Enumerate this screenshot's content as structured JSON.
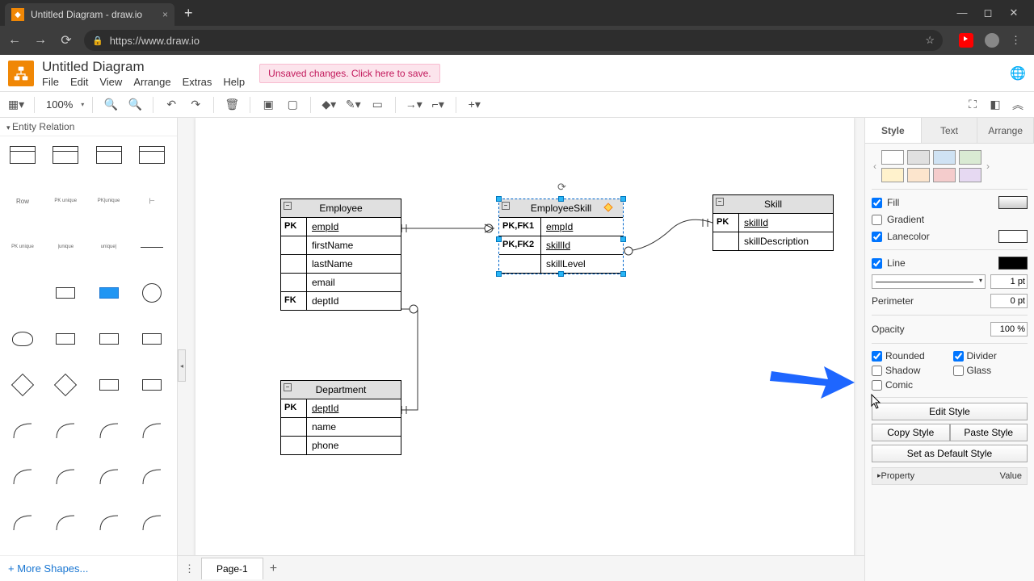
{
  "browser": {
    "tab_title": "Untitled Diagram - draw.io",
    "url": "https://www.draw.io"
  },
  "app": {
    "title": "Untitled Diagram",
    "menus": [
      "File",
      "Edit",
      "View",
      "Arrange",
      "Extras",
      "Help"
    ],
    "save_banner": "Unsaved changes. Click here to save."
  },
  "toolbar": {
    "zoom": "100%"
  },
  "sidebar": {
    "section": "Entity Relation",
    "more": "+ More Shapes..."
  },
  "canvas": {
    "tables": {
      "employee": {
        "title": "Employee",
        "rows": [
          {
            "key": "PK",
            "field": "empId",
            "u": true
          },
          {
            "key": "",
            "field": "firstName"
          },
          {
            "key": "",
            "field": "lastName"
          },
          {
            "key": "",
            "field": "email"
          },
          {
            "key": "FK",
            "field": "deptId"
          }
        ]
      },
      "employeeskill": {
        "title": "EmployeeSkill",
        "rows": [
          {
            "key": "PK,FK1",
            "field": "empId",
            "u": true
          },
          {
            "key": "PK,FK2",
            "field": "skillId",
            "u": true
          },
          {
            "key": "",
            "field": "skillLevel"
          }
        ]
      },
      "skill": {
        "title": "Skill",
        "rows": [
          {
            "key": "PK",
            "field": "skillId",
            "u": true
          },
          {
            "key": "",
            "field": "skillDescription"
          }
        ]
      },
      "department": {
        "title": "Department",
        "rows": [
          {
            "key": "PK",
            "field": "deptId",
            "u": true
          },
          {
            "key": "",
            "field": "name"
          },
          {
            "key": "",
            "field": "phone"
          }
        ]
      }
    }
  },
  "right": {
    "tabs": [
      "Style",
      "Text",
      "Arrange"
    ],
    "fill": "Fill",
    "gradient": "Gradient",
    "lanecolor": "Lanecolor",
    "line": "Line",
    "line_pt": "1 pt",
    "perimeter": "Perimeter",
    "perimeter_val": "0 pt",
    "opacity": "Opacity",
    "opacity_val": "100 %",
    "rounded": "Rounded",
    "divider": "Divider",
    "shadow": "Shadow",
    "glass": "Glass",
    "comic": "Comic",
    "edit_style": "Edit Style",
    "copy_style": "Copy Style",
    "paste_style": "Paste Style",
    "set_default": "Set as Default Style",
    "property": "Property",
    "value": "Value"
  },
  "pages": {
    "page1": "Page-1"
  },
  "colors": {
    "swatches_top": [
      "#ffffff",
      "#e0e0e0",
      "#cfe2f3",
      "#d9ead3"
    ],
    "swatches_bot": [
      "#fff2cc",
      "#fce5cd",
      "#f4cccc",
      "#e6d9f2"
    ]
  }
}
